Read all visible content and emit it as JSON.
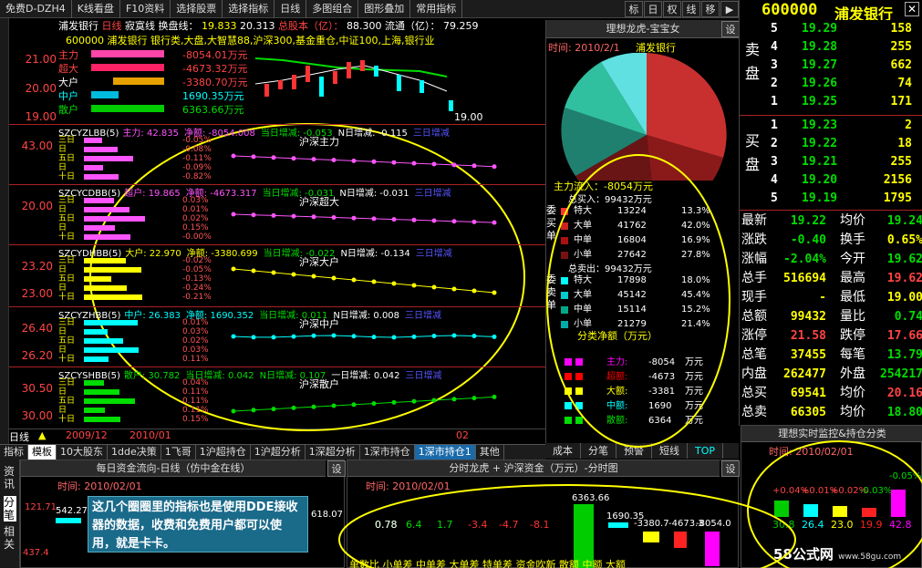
{
  "menu": {
    "items": [
      "免费D-DZH4",
      "K线看盘",
      "F10资料",
      "选择股票",
      "选择指标",
      "日线",
      "多图组合",
      "图形叠加",
      "常用指标"
    ],
    "icons": [
      "标",
      "日",
      "权",
      "线",
      "移"
    ]
  },
  "stock": {
    "code": "600000",
    "name": "浦发银行"
  },
  "chart": {
    "info1": {
      "name": "浦发银行",
      "period": "日线",
      "ind": "寂寞线",
      "label1": "换盘线：",
      "v1": "19.833",
      "v2": "20.313",
      "cap_label": "总股本（亿）：",
      "cap": "88.300",
      "float_label": "流通（亿）：",
      "float": "79.259"
    },
    "info2": "600000 浦发银行 银行类,大盘,大智慧88,沪深300,基金重仓,中证100,上海,银行业",
    "yaxis": [
      "21.00",
      "20.00",
      "19.00"
    ],
    "main_rows": [
      {
        "label": "主力",
        "value": "-8054.01万元",
        "color": "#ff4444"
      },
      {
        "label": "超大",
        "value": "-4673.32万元",
        "color": "#ff4444"
      },
      {
        "label": "大户",
        "value": "-3380.70万元",
        "color": "#ff4444"
      },
      {
        "label": "中户",
        "value": "1690.35万元",
        "color": "#00ffff"
      },
      {
        "label": "散户",
        "value": "6363.66万元",
        "color": "#00dd00"
      }
    ],
    "low_mark": "19.00"
  },
  "panels": [
    {
      "name": "SZCYZLBB(5)",
      "label": "主力: 42.835",
      "net": "净额: -8054.008",
      "d1": "当日增减: -0.053",
      "dn": "N日增减: -0.115",
      "d3": "三日增减",
      "title": "沪深主力",
      "rows": [
        "-0.05%",
        "-0.08%",
        "-0.11%",
        "-0.09%",
        "-0.82%"
      ],
      "axis": "43.00",
      "color": "#ff55ff"
    },
    {
      "name": "SZCYCDBB(5)",
      "label": "超户: 19.865",
      "net": "净额: -4673.317",
      "d1": "当日增减: -0.031",
      "dn": "N日增减: -0.031",
      "d3": "三日增减",
      "title": "沪深超大",
      "rows": [
        "0.03%",
        "0.01%",
        "0.02%",
        "0.15%",
        "-0.00%"
      ],
      "axis": "20.00",
      "color": "#ff55ff"
    },
    {
      "name": "SZCYDHBB(5)",
      "label": "大户: 22.970",
      "net": "净额: -3380.699",
      "d1": "当日增减: -0.022",
      "dn": "N日增减: -0.134",
      "d3": "三日增减",
      "title": "沪深大户",
      "rows": [
        "-0.02%",
        "-0.05%",
        "-0.13%",
        "-0.24%",
        "-0.21%"
      ],
      "axis": "23.20",
      "axis2": "23.00",
      "color": "#ffff00"
    },
    {
      "name": "SZCYZHBB(5)",
      "label": "中户: 26.383",
      "net": "净额: 1690.352",
      "d1": "当日增减: 0.011",
      "dn": "N日增减: 0.008",
      "d3": "三日增减",
      "title": "沪深中户",
      "rows": [
        "0.01%",
        "0.03%",
        "0.02%",
        "0.03%",
        "0.11%"
      ],
      "axis": "26.40",
      "axis2": "26.20",
      "color": "#00ffff"
    },
    {
      "name": "SZCYSHBB(5)",
      "label": "散户: 30.782",
      "net": "当日增减: 0.042",
      "d1": "N日增减: 0.107",
      "dn": "一日增减: 0.042",
      "d3": "三日增减",
      "title": "沪深散户",
      "rows": [
        "0.04%",
        "0.11%",
        "0.11%",
        "0.11%",
        "0.15%"
      ],
      "axis": "30.50",
      "axis2": "30.00",
      "color": "#00dd00"
    }
  ],
  "xaxis": {
    "period": "日线",
    "d1": "2009/12",
    "d2": "2010/01",
    "d3": "02"
  },
  "side": {
    "title": "理想龙虎-宝宝女",
    "time": "时间: 2010/2/1",
    "stock": "浦发银行",
    "inflow": "主力流入：-8054万元",
    "buy_total": "总买入：99432万元",
    "sell_total": "总卖出：99432万元",
    "buy": [
      {
        "k": "特大",
        "v": "13224",
        "p": "13.3%"
      },
      {
        "k": "大单",
        "v": "41762",
        "p": "42.0%"
      },
      {
        "k": "中单",
        "v": "16804",
        "p": "16.9%"
      },
      {
        "k": "小单",
        "v": "27642",
        "p": "27.8%"
      }
    ],
    "sell": [
      {
        "k": "特大",
        "v": "17898",
        "p": "18.0%"
      },
      {
        "k": "大单",
        "v": "45142",
        "p": "45.4%"
      },
      {
        "k": "中单",
        "v": "15114",
        "p": "15.2%"
      },
      {
        "k": "小单",
        "v": "21279",
        "p": "21.4%"
      }
    ],
    "buy_side": "委买单",
    "sell_side": "委卖单",
    "cls_title": "分类净额（万元）",
    "cls": [
      {
        "k": "主力:",
        "v": "-8054",
        "u": "万元",
        "c": "#ff00ff"
      },
      {
        "k": "超额:",
        "v": "-4673",
        "u": "万元",
        "c": "#ff0000"
      },
      {
        "k": "大额:",
        "v": "-3381",
        "u": "万元",
        "c": "#ffff00"
      },
      {
        "k": "中额:",
        "v": "1690",
        "u": "万元",
        "c": "#00ffff"
      },
      {
        "k": "散额:",
        "v": "6364",
        "u": "万元",
        "c": "#00dd00"
      }
    ],
    "tabs": [
      "成本",
      "分笔",
      "预警",
      "短线",
      "TOP"
    ]
  },
  "orderbook": {
    "sell_label": "卖盘",
    "buy_label": "买盘",
    "sell": [
      {
        "n": "5",
        "p": "19.29",
        "v": "158"
      },
      {
        "n": "4",
        "p": "19.28",
        "v": "255"
      },
      {
        "n": "3",
        "p": "19.27",
        "v": "662"
      },
      {
        "n": "2",
        "p": "19.26",
        "v": "74"
      },
      {
        "n": "1",
        "p": "19.25",
        "v": "171"
      }
    ],
    "buy": [
      {
        "n": "1",
        "p": "19.23",
        "v": "2"
      },
      {
        "n": "2",
        "p": "19.22",
        "v": "18"
      },
      {
        "n": "3",
        "p": "19.21",
        "v": "255"
      },
      {
        "n": "4",
        "p": "19.20",
        "v": "2156"
      },
      {
        "n": "5",
        "p": "19.19",
        "v": "1795"
      }
    ]
  },
  "quote": [
    {
      "k1": "最新",
      "v1": "19.22",
      "k2": "均价",
      "v2": "19.24"
    },
    {
      "k1": "涨跌",
      "v1": "-0.40",
      "k2": "换手",
      "v2": "0.65%"
    },
    {
      "k1": "涨幅",
      "v1": "-2.04%",
      "k2": "今开",
      "v2": "19.62"
    },
    {
      "k1": "总手",
      "v1": "516694",
      "k2": "最高",
      "v2": "19.62"
    },
    {
      "k1": "现手",
      "v1": "-",
      "k2": "最低",
      "v2": "19.00"
    },
    {
      "k1": "总额",
      "v1": "99432",
      "k2": "量比",
      "v2": "0.74"
    },
    {
      "k1": "涨停",
      "v1": "21.58",
      "k2": "跌停",
      "v2": "17.66"
    },
    {
      "k1": "总笔",
      "v1": "37455",
      "k2": "每笔",
      "v2": "13.79"
    },
    {
      "k1": "内盘",
      "v1": "262477",
      "k2": "外盘",
      "v2": "254217"
    },
    {
      "k1": "总买",
      "v1": "69541",
      "k2": "均价",
      "v2": "20.16"
    },
    {
      "k1": "总卖",
      "v1": "66305",
      "k2": "均价",
      "v2": "18.80"
    }
  ],
  "bottomtabs": [
    "指标",
    "模板",
    "10大股东",
    "1dde决策",
    "1飞哥",
    "1沪超持仓",
    "1沪超分析",
    "1深超分析",
    "1深市持仓",
    "1深市持仓1",
    "其他"
  ],
  "bp1": {
    "title": "每日资金流向-日线（仿中金在线）",
    "time": "时间: 2010/02/01",
    "vals": [
      "542.27",
      "618.07"
    ],
    "yaxis": [
      "121.71",
      "437.4"
    ]
  },
  "bp2": {
    "title": "分时龙虎 + 沪深资金（万元）-分时图",
    "time": "时间: 2010/02/01",
    "vals": [
      "0.78",
      "6.4",
      "1.7",
      "-3.4",
      "-4.7",
      "-8.1"
    ],
    "bigvals": [
      "6363.66",
      "1690.35",
      "-3380.7",
      "-4673.3",
      "-8054.0"
    ],
    "cats": "单数比 小单差 中单差 大单差 特单差 资金吹新 散额 中额 大额"
  },
  "bp3": {
    "title": "理想实时监控&持仓分类",
    "time": "时间: 2010/02/01",
    "vals": [
      "+0.04%",
      "+0.01%",
      "+0.02%",
      "-0.03%",
      "-0.05%"
    ],
    "nums": [
      "30.8",
      "26.4",
      "23.0",
      "19.9",
      "42.8"
    ]
  },
  "note": "这几个圈圈里的指标也是使用DDE接收器的数据，收费和免费用户都可以使用，就是卡卡。",
  "left_tabs": [
    "资讯",
    "分笔",
    "相关"
  ],
  "logo": "58公式网",
  "logo_url": "www.58gu.com",
  "settings": "设"
}
